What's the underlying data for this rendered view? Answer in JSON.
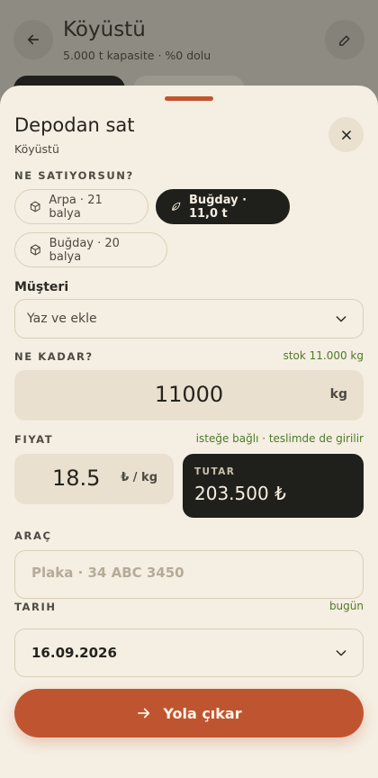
{
  "background": {
    "title": "Köyüstü",
    "subtitle": "5.000 t kapasite · %0 dolu"
  },
  "sheet": {
    "title": "Depodan sat",
    "subtitle": "Köyüstü",
    "product_label": "NE SATIYORSUN?",
    "products": [
      {
        "label": "Arpa · 21 balya",
        "icon": "box-icon",
        "active": false
      },
      {
        "label": "Buğday · 11,0 t",
        "icon": "leaf-icon",
        "active": true
      },
      {
        "label": "Buğday · 20 balya",
        "icon": "box-icon",
        "active": false
      }
    ],
    "customer_label": "Müşteri",
    "customer_value": "Yaz ve ekle",
    "quantity_label": "NE KADAR?",
    "stock_hint": "stok 11.000 kg",
    "quantity_value": "11000",
    "quantity_unit": "kg",
    "price_label": "FIYAT",
    "price_hint": "isteğe bağlı · teslimde de girilir",
    "price_value": "18.5",
    "price_unit": "₺ / kg",
    "total_label": "TUTAR",
    "total_value": "203.500 ₺",
    "vehicle_label": "ARAÇ",
    "plate_placeholder": "Plaka · 34 ABC 3450",
    "date_label": "TARIH",
    "date_hint": "bugün",
    "date_value": "16.09.2026",
    "submit_label": "Yola çıkar"
  },
  "colors": {
    "accent": "#bf5530",
    "dark": "#1f201b",
    "hint_green": "#4f7a2c",
    "sheet_bg": "#f5eee2"
  }
}
